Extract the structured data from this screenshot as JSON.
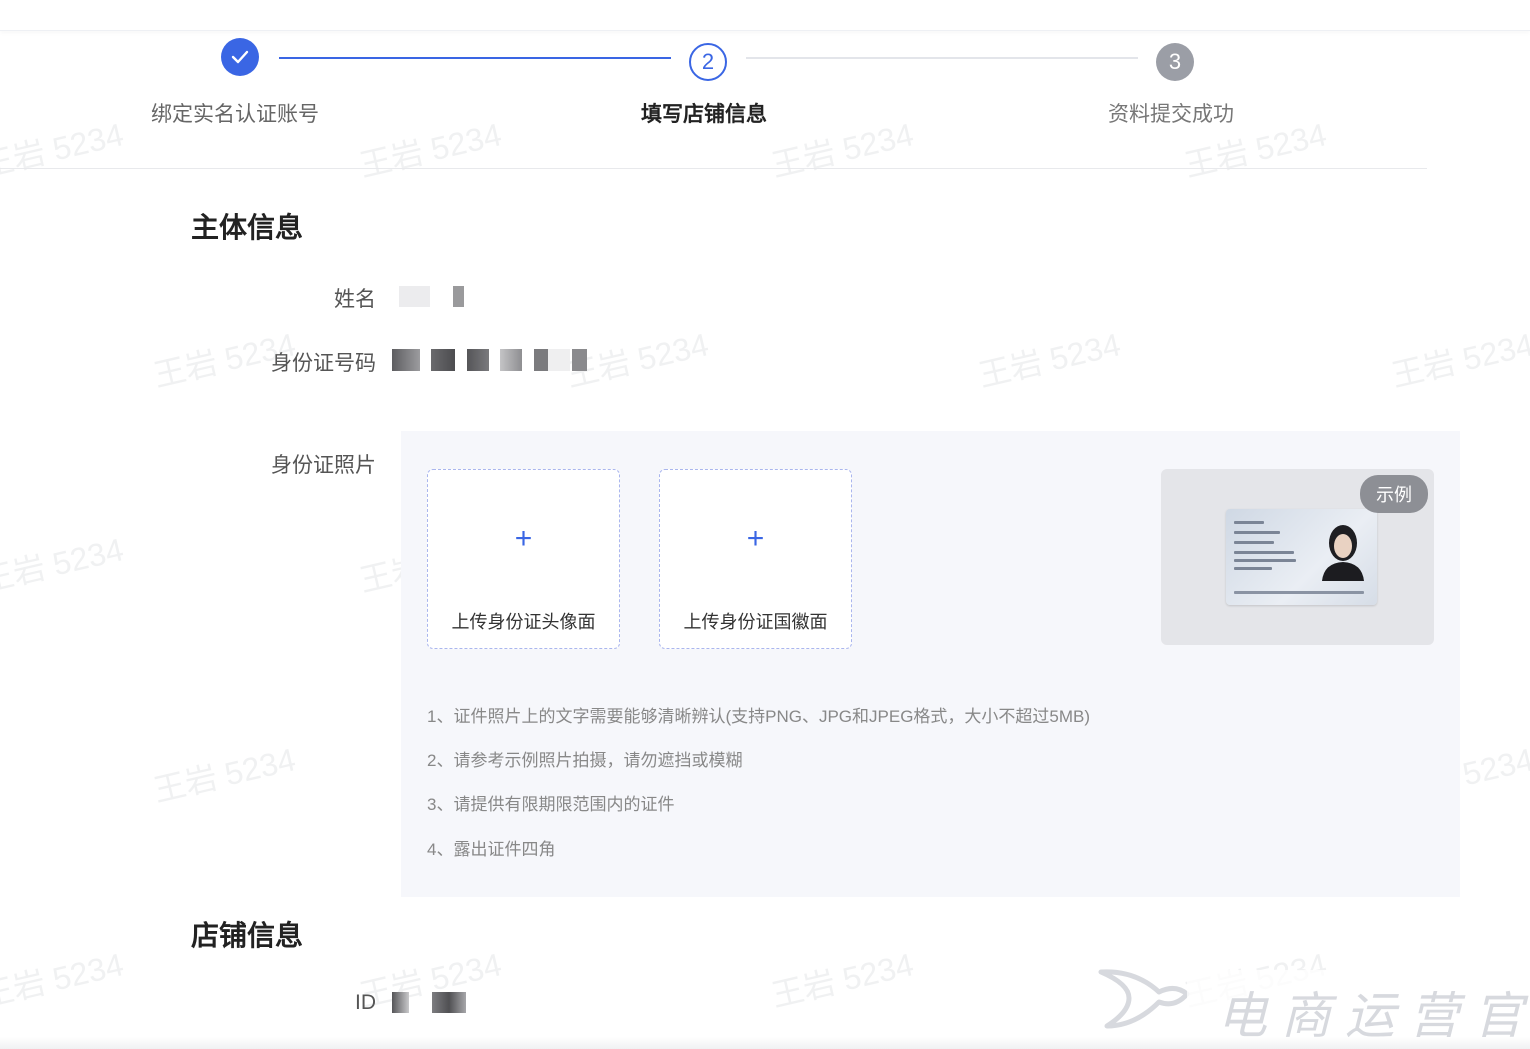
{
  "steps": [
    {
      "label": "绑定实名认证账号",
      "number": "1",
      "status": "done"
    },
    {
      "label": "填写店铺信息",
      "number": "2",
      "status": "active"
    },
    {
      "label": "资料提交成功",
      "number": "3",
      "status": "todo"
    }
  ],
  "subject_section": {
    "title": "主体信息",
    "name_label": "姓名",
    "id_number_label": "身份证号码",
    "id_photo_label": "身份证照片",
    "upload_front": "上传身份证头像面",
    "upload_back": "上传身份证国徽面",
    "plus_symbol": "+",
    "example_badge": "示例",
    "rules": [
      "1、证件照片上的文字需要能够清晰辨认(支持PNG、JPG和JPEG格式，大小不超过5MB)",
      "2、请参考示例照片拍摄，请勿遮挡或模糊",
      "3、请提供有限期限范围内的证件",
      "4、露出证件四角"
    ]
  },
  "shop_section": {
    "title": "店铺信息",
    "id_label": "ID"
  },
  "watermark_text": "王岩 5234",
  "corner_brand": "电商运营官",
  "colors": {
    "accent": "#3a66e4",
    "panel": "#f6f7fb"
  }
}
